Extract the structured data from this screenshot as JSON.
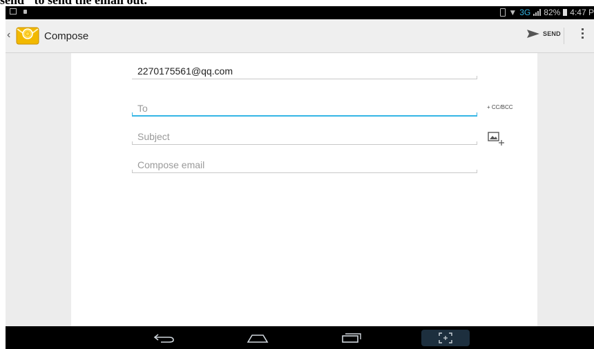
{
  "caption": {
    "text": "send\" to send the email out."
  },
  "statusbar": {
    "network": "3G",
    "battery": "82%",
    "time": "4:47 P"
  },
  "actionbar": {
    "title": "Compose",
    "send_label": "SEND"
  },
  "compose": {
    "from": "2270175561@qq.com",
    "to_placeholder": "To",
    "cc_bcc_label": "+ CC/BCC",
    "subject_placeholder": "Subject",
    "body_placeholder": "Compose email"
  },
  "colors": {
    "accent": "#33b5e5",
    "navbar": "#000000",
    "background": "#ececec"
  },
  "icons": {
    "actionbar": [
      "back-icon",
      "email-app-icon",
      "send-icon",
      "overflow-menu-icon"
    ],
    "compose": [
      "attach-picture-icon"
    ],
    "navbar": [
      "nav-back-icon",
      "nav-home-icon",
      "nav-recent-apps-icon",
      "screenshot-icon"
    ]
  }
}
